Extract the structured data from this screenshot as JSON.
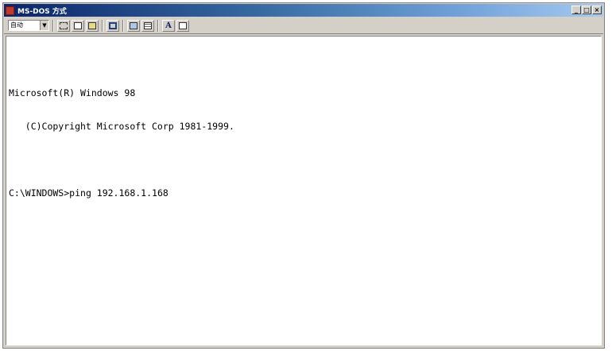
{
  "window": {
    "title": "MS-DOS 方式"
  },
  "titlebar_buttons": {
    "minimize": "_",
    "maximize": "□",
    "close": "×"
  },
  "toolbar": {
    "font_size_value": "自动",
    "font_button_label": "A"
  },
  "console": {
    "banner_line1": "Microsoft(R) Windows 98",
    "banner_line2": "   (C)Copyright Microsoft Corp 1981-1999.",
    "prompt": "C:\\WINDOWS>",
    "command": "ping 192.168.1.168"
  }
}
